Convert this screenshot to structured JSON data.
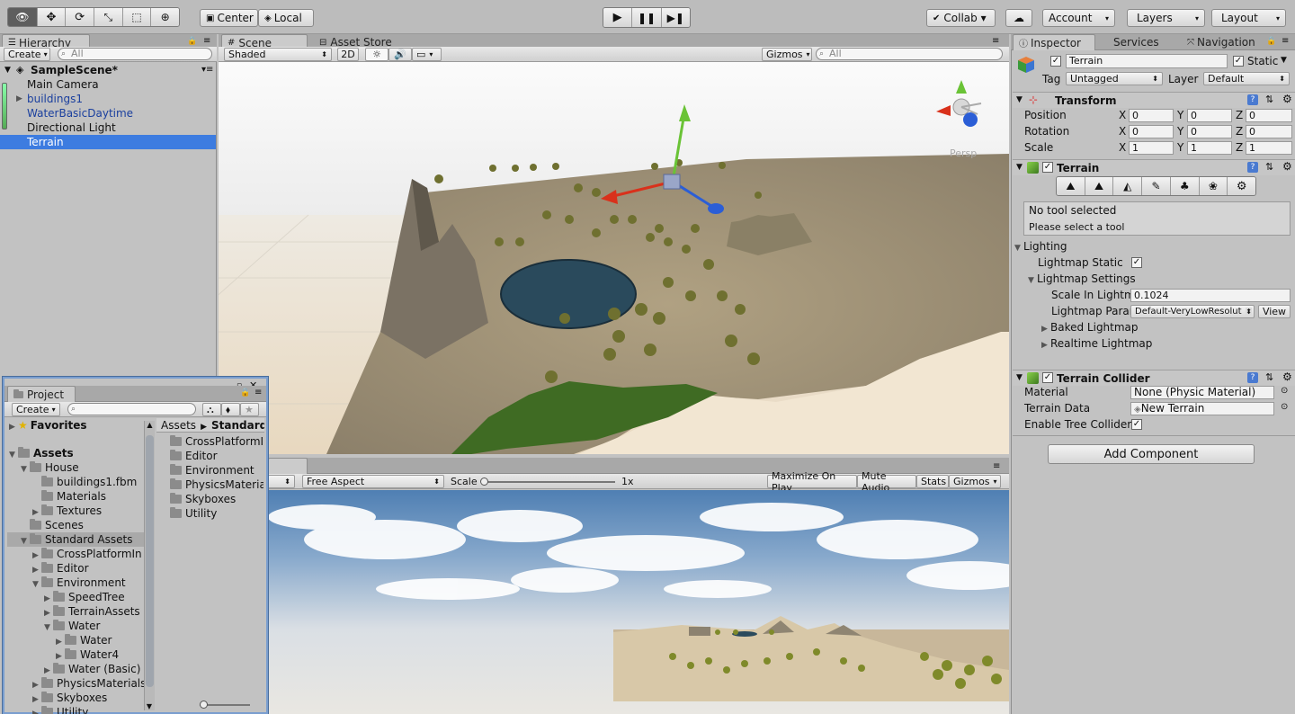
{
  "toolbar": {
    "pivot_center": "Center",
    "pivot_local": "Local",
    "collab": "Collab ▾",
    "account": "Account",
    "layers": "Layers",
    "layout": "Layout"
  },
  "hierarchy": {
    "tab": "Hierarchy",
    "create": "Create",
    "search_placeholder": "All",
    "scene": "SampleScene*",
    "items": [
      "Main Camera",
      "buildings1",
      "WaterBasicDaytime",
      "Directional Light",
      "Terrain"
    ]
  },
  "scene": {
    "tab_scene": "Scene",
    "tab_store": "Asset Store",
    "shading": "Shaded",
    "mode2d": "2D",
    "gizmos": "Gizmos",
    "search_placeholder": "All",
    "persp": "Persp"
  },
  "game": {
    "aspect": "Free Aspect",
    "scale_label": "Scale",
    "scale_value": "1x",
    "maximize": "Maximize On Play",
    "mute": "Mute Audio",
    "stats": "Stats",
    "gizmos": "Gizmos"
  },
  "project": {
    "tab": "Project",
    "create": "Create",
    "favorites": "Favorites",
    "assets": "Assets",
    "tree": [
      {
        "label": "House",
        "indent": 1,
        "open": true
      },
      {
        "label": "buildings1.fbm",
        "indent": 2,
        "open": null
      },
      {
        "label": "Materials",
        "indent": 2,
        "open": null
      },
      {
        "label": "Textures",
        "indent": 2,
        "open": false
      },
      {
        "label": "Scenes",
        "indent": 1,
        "open": null
      },
      {
        "label": "Standard Assets",
        "indent": 1,
        "open": true
      },
      {
        "label": "CrossPlatformIn",
        "indent": 2,
        "open": false
      },
      {
        "label": "Editor",
        "indent": 2,
        "open": false
      },
      {
        "label": "Environment",
        "indent": 2,
        "open": true
      },
      {
        "label": "SpeedTree",
        "indent": 3,
        "open": false
      },
      {
        "label": "TerrainAssets",
        "indent": 3,
        "open": false
      },
      {
        "label": "Water",
        "indent": 3,
        "open": true
      },
      {
        "label": "Water",
        "indent": 4,
        "open": false
      },
      {
        "label": "Water4",
        "indent": 4,
        "open": false
      },
      {
        "label": "Water (Basic)",
        "indent": 3,
        "open": false
      },
      {
        "label": "PhysicsMaterials",
        "indent": 2,
        "open": false
      },
      {
        "label": "Skyboxes",
        "indent": 2,
        "open": false
      },
      {
        "label": "Utility",
        "indent": 2,
        "open": false
      }
    ],
    "breadcrumb_root": "Assets",
    "breadcrumb_current": "Standard",
    "folder_items": [
      "CrossPlatformI",
      "Editor",
      "Environment",
      "PhysicsMaterial",
      "Skyboxes",
      "Utility"
    ]
  },
  "inspector": {
    "tab_inspector": "Inspector",
    "tab_services": "Services",
    "tab_navigation": "Navigation",
    "object_name": "Terrain",
    "static_label": "Static",
    "tag_label": "Tag",
    "tag_value": "Untagged",
    "layer_label": "Layer",
    "layer_value": "Default",
    "transform": {
      "title": "Transform",
      "rows": [
        {
          "label": "Position",
          "x": "0",
          "y": "0",
          "z": "0"
        },
        {
          "label": "Rotation",
          "x": "0",
          "y": "0",
          "z": "0"
        },
        {
          "label": "Scale",
          "x": "1",
          "y": "1",
          "z": "1"
        }
      ]
    },
    "terrain": {
      "title": "Terrain",
      "no_tool": "No tool selected",
      "select_tool": "Please select a tool",
      "lighting": "Lighting",
      "lightmap_static": "Lightmap Static",
      "lightmap_settings": "Lightmap Settings",
      "scale_in_lightmap_label": "Scale In Lightm",
      "scale_in_lightmap_value": "0.1024",
      "lightmap_param_label": "Lightmap Parar",
      "lightmap_param_value": "Default-VeryLowResolut",
      "view_button": "View",
      "baked_lightmap": "Baked Lightmap",
      "realtime_lightmap": "Realtime Lightmap"
    },
    "collider": {
      "title": "Terrain Collider",
      "material_label": "Material",
      "material_value": "None (Physic Material)",
      "terrain_data_label": "Terrain Data",
      "terrain_data_value": "New Terrain",
      "enable_tree_label": "Enable Tree Collider"
    },
    "add_component": "Add Component"
  }
}
